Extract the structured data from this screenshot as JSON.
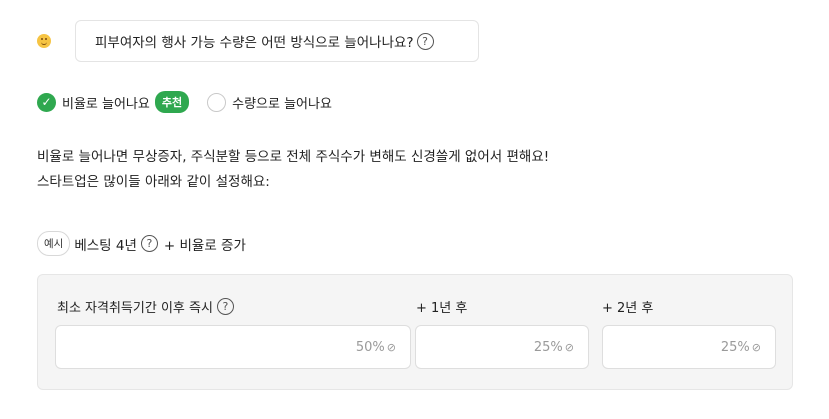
{
  "question": {
    "text": "피부여자의 행사 가능 수량은 어떤 방식으로 늘어나나요?",
    "help": "?"
  },
  "options": [
    {
      "label": "비율로 늘어나요",
      "badge": "추천",
      "selected": true
    },
    {
      "label": "수량으로 늘어나요",
      "selected": false
    }
  ],
  "description": {
    "line1": "비율로 늘어나면 무상증자, 주식분할 등으로 전체 주식수가 변해도 신경쓸게 없어서 편해요!",
    "line2": "스타트업은 많이들 아래와 같이 설정해요:"
  },
  "example": {
    "badge": "예시",
    "text_before": "베스팅 4년",
    "text_after": "+ 비율로 증가",
    "help": "?"
  },
  "vesting": {
    "columns": [
      {
        "label": "최소 자격취득기간 이후 즉시",
        "value": "50%",
        "has_help": true
      },
      {
        "label": "+ 1년 후",
        "value": "25%",
        "has_help": false
      },
      {
        "label": "+ 2년 후",
        "value": "25%",
        "has_help": false
      }
    ],
    "help": "?",
    "unit_icon": "percent-check-icon"
  },
  "colors": {
    "accent_green": "#2fa84f",
    "panel_bg": "#f5f5f5"
  }
}
